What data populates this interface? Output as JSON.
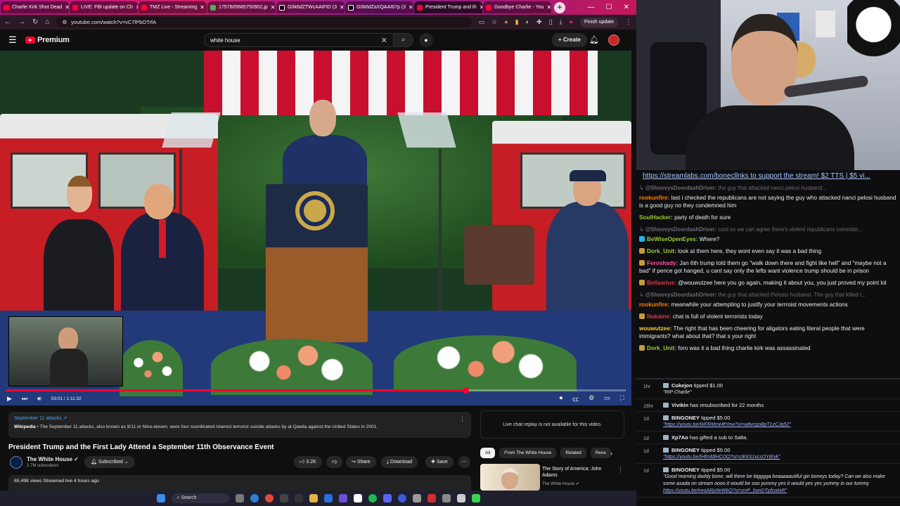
{
  "browser": {
    "tabs": [
      {
        "label": "Charlie Kirk Shot Dead"
      },
      {
        "label": "LIVE: FBI update on Ch"
      },
      {
        "label": "TMZ Live - Streaming"
      },
      {
        "label": "1757605685750902.jp"
      },
      {
        "label": "G0k6dZTWcAAIFID (3"
      },
      {
        "label": "G0k6dZaXQAAI67p (3"
      },
      {
        "label": "President Trump and th"
      },
      {
        "label": "Goodbye Charlie - You"
      }
    ],
    "new_tab": "+",
    "url": "youtube.com/watch?v=vC7lPbOTrfA",
    "finish_update": "Finish update"
  },
  "youtube": {
    "logo_text": "Premium",
    "search_value": "white house",
    "create_label": "Create",
    "video": {
      "current_time": "53:01",
      "duration": "1:11:32",
      "progress": 0.741
    },
    "description": {
      "topic": "September 11 attacks",
      "source": "Wikipedia",
      "text": " • The September 11 attacks, also known as 9/11 or Nine-eleven, were four coordinated Islamist terrorist suicide attacks by al-Qaeda against the United States in 2001."
    },
    "title": "President Trump and the First Lady Attend a September 11th Observance Event",
    "channel": {
      "name": "The White House",
      "subs": "2.7M subscribers",
      "subscribed_label": "Subscribed"
    },
    "actions": {
      "likes": "3.2K",
      "share": "Share",
      "download": "Download",
      "save": "Save"
    },
    "meta": "65,498 views  Streamed live 4 hours ago",
    "live_chat_note": "Live chat replay is not available for this video.",
    "chips": [
      "All",
      "From The White House",
      "Related",
      "Rece"
    ],
    "recommendation": {
      "title": "The Story of America: John Adams",
      "channel": "The White House"
    },
    "taskbar_search": "Search"
  },
  "stream": {
    "link_url": "https://streamlabs.com/bonecllnks",
    "link_rest": " to support the stream! $2 TTS | $5 vi..."
  },
  "chat": [
    {
      "type": "reply",
      "user": "@ShoovysDoordashDriver:",
      "text": "the guy that attacked nanci pelosi husband..."
    },
    {
      "type": "msg",
      "user": "rookunfire:",
      "color": "#ff7f00",
      "text": "last i checked the republicans are not saying the guy who attacked nanci pelosi husband is a good guy no they condemned him"
    },
    {
      "type": "msg",
      "user": "SoulHacker:",
      "color": "#9acd32",
      "text": "party of death for sure"
    },
    {
      "type": "reply",
      "user": "@ShoovysDoordashDriver:",
      "text": "cool so we can agree there's violent republicans commitin..."
    },
    {
      "type": "msg",
      "user": "BeWiseOpenEyes:",
      "color": "#9acd32",
      "text": "Where?",
      "badge": "b2"
    },
    {
      "type": "msg",
      "user": "Dork_Unit:",
      "color": "#9acd32",
      "text": "look at them here, they wont even say it was a bad thing",
      "badge": "b1"
    },
    {
      "type": "msg",
      "user": "Feroshady:",
      "color": "#ff4fa3",
      "text": "Jan 6th trump told them go \"walk down there and fight like hell\" and \"maybe not a bad\" if pence got hanged, u cant say only the lefts want violence trump should be in prison",
      "badge": "b1"
    },
    {
      "type": "msg",
      "user": "Bellaarius:",
      "color": "#e0334a",
      "text": "@wouwutzee here you go again, making it about you, you just proved my point lol",
      "badge": "b1"
    },
    {
      "type": "reply",
      "user": "@ShoovysDoordashDriver:",
      "text": "the guy that attacked Pelosis husband. The guy that killed t..."
    },
    {
      "type": "msg",
      "user": "rookunfire:",
      "color": "#ff7f00",
      "text": "meanwhile your attempting to justify your terrroist movements actions"
    },
    {
      "type": "msg",
      "user": "Nukaine:",
      "color": "#e0334a",
      "text": "chat is full of violent terrorists today",
      "badge": "b1"
    },
    {
      "type": "msg",
      "user": "wouwutzee:",
      "color": "#ffcc33",
      "text": "The right that has been cheering for aligators eating literal people that were immigrants? what about that? that s your right"
    },
    {
      "type": "msg",
      "user": "Dork_Unit:",
      "color": "#9acd32",
      "text": "foro was it a bad thing charlie kirk was assassinated",
      "badge": "b1"
    }
  ],
  "events": [
    {
      "time": "1hr",
      "user": "Cokejon",
      "action": "tipped $1.00",
      "message": "\"RIP Charlie\""
    },
    {
      "time": "16hr",
      "user": "Vivikin",
      "action": "has resubscribed for 22 months",
      "message": ""
    },
    {
      "time": "1d",
      "user": "BINGONEY",
      "action": "tipped $5.00",
      "message": "",
      "link": "\"https://youtu.be/WFRMmHftYew?si=w8vcgoBpT1zCJq52\""
    },
    {
      "time": "1d",
      "user": "Xp7Ao",
      "action": "has gifted a sub to Salta.",
      "message": ""
    },
    {
      "time": "1d",
      "user": "BINGONEY",
      "action": "tipped $5.00",
      "message": "",
      "link": "\"https://youtu.be/IHfmfdlHCOQ?si=clKkS1xcsOYjEyk\""
    },
    {
      "time": "1d",
      "user": "BINGONEY",
      "action": "tipped $5.00",
      "message": "\"Good morning daddy bone, will there be bigggga beaaaaautiful gin boneys today? Can we also make some asada on stream oooo it would be soo yummy yes it would yes yes yummy in our tummy ",
      "link": "https://youtu.be/eeoARp9eWbQ?si=znP_bonDTpfcwtxR\""
    }
  ],
  "colors": {
    "yt_red": "#ff0033",
    "chip_selected": "#f1f1f1",
    "link_blue": "#3ea6ff"
  }
}
